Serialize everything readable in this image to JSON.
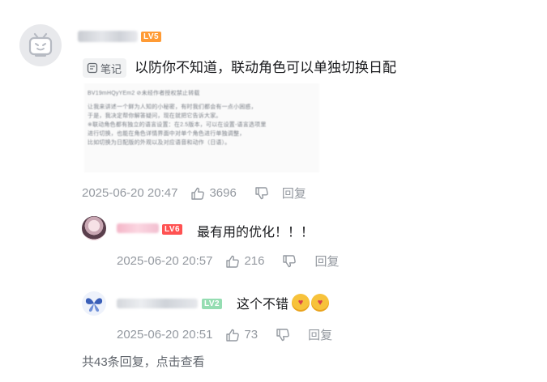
{
  "comment": {
    "level": "LV5",
    "note_tag": "笔记",
    "text": "以防你不知道，联动角色可以单独切换日配",
    "note_lines": [
      "BV19mHQyYEm2 ⊘未经作者授权禁止转载",
      "让我来讲述一个鲜为人知的小秘密，有时我们都会有一点小困惑，",
      "于是，我决定帮你解答疑问，现在就把它告诉大家。",
      "",
      "※联动角色都有独立的语言设置：在2.5版本，可以在设置-语言选项里",
      "进行切换，也能在角色详情界面中对单个角色进行单独调整，",
      "比如切换为日配版的外观以及对应语音和动作（日语）。"
    ],
    "timestamp": "2025-06-20 20:47",
    "likes": "3696",
    "reply_label": "回复"
  },
  "replies": [
    {
      "level": "LV6",
      "text": "最有用的优化！！！",
      "timestamp": "2025-06-20 20:57",
      "likes": "216",
      "reply_label": "回复"
    },
    {
      "level": "LV2",
      "text": "这个不错",
      "timestamp": "2025-06-20 20:51",
      "likes": "73",
      "reply_label": "回复"
    }
  ],
  "more_replies": "共43条回复，点击查看",
  "colors": {
    "lv5": "#ff9b35",
    "lv6": "#ff5252",
    "lv2": "#95ddb2",
    "meta": "#9499a0"
  }
}
